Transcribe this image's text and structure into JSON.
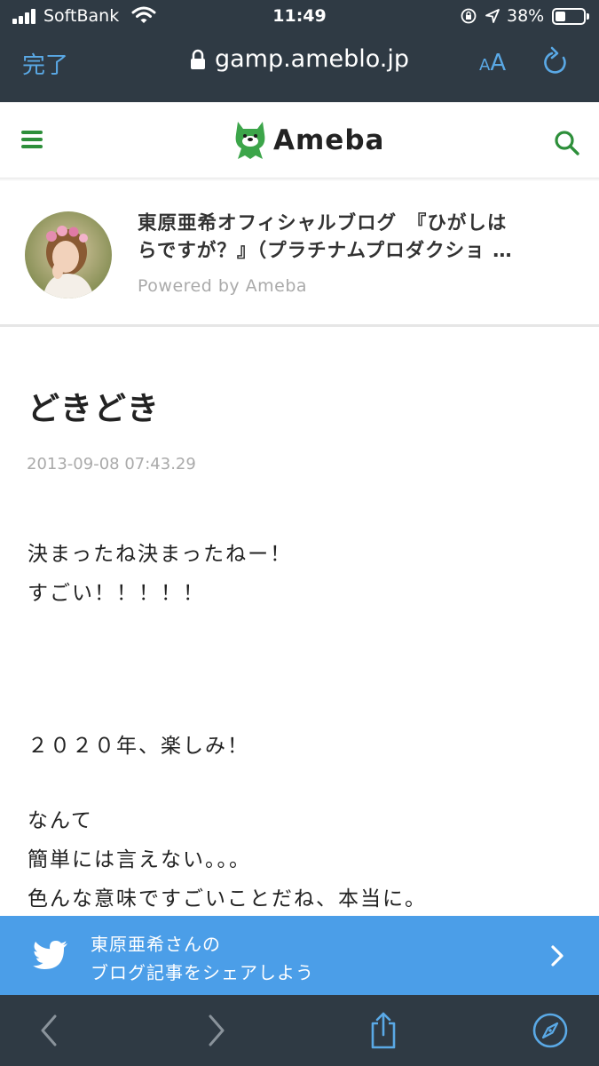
{
  "status_bar": {
    "carrier": "SoftBank",
    "time": "11:49",
    "battery": "38%",
    "battery_level": 0.38,
    "icons": [
      "signal-icon",
      "wifi-icon",
      "orientation-lock-icon",
      "location-arrow-icon",
      "battery-icon"
    ]
  },
  "browser": {
    "done_label": "完了",
    "url": "gamp.ameblo.jp",
    "aa_label_small": "A",
    "aa_label_large": "A",
    "icons": [
      "lock-icon",
      "reload-icon"
    ]
  },
  "header": {
    "logo_text": "Ameba",
    "icons": [
      "hamburger-icon",
      "ameba-mascot-icon",
      "search-icon"
    ],
    "accent_color": "#2d8f3a"
  },
  "blog": {
    "title_line1": "東原亜希オフィシャルブログ　『ひがしは",
    "title_line2": "らですが？』（プラチナムプロダクショ …",
    "powered_by": "Powered by Ameba"
  },
  "article": {
    "title": "どきどき",
    "date": "2013-09-08 07:43.29",
    "lines": [
      "決まったね決まったねー！",
      "すごい！！！！！",
      "２０２０年、楽しみ！",
      "なんて",
      "簡単には言えない。。。",
      "色んな意味ですごいことだね、本当に。"
    ]
  },
  "share": {
    "line1": "東原亜希さんの",
    "line2": "ブログ記事をシェアしよう",
    "color": "#4b9ee8",
    "icons": [
      "twitter-icon",
      "chevron-right-icon"
    ]
  },
  "toolbar": {
    "icons": [
      "back-icon",
      "forward-icon",
      "share-icon",
      "compass-icon"
    ],
    "background": "#2f3a44"
  }
}
